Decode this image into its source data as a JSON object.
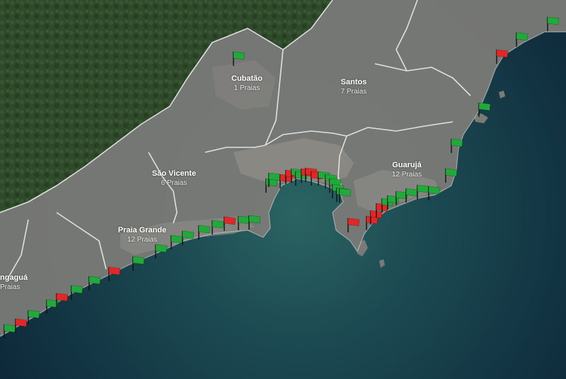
{
  "colors": {
    "forest": "#2f4a2c",
    "land": "#7a7a77",
    "border": "#e9e9e9",
    "sea_near": "#245c5c",
    "sea_far": "#0d2a3a",
    "flag_good": "#1faa3a",
    "flag_bad": "#e32626"
  },
  "cities": [
    {
      "name": "Cubatão",
      "count": "1 Praias"
    },
    {
      "name": "Santos",
      "count": "7 Praias"
    },
    {
      "name": "São Vicente",
      "count": "6 Praias"
    },
    {
      "name": "Guarujá",
      "count": "12 Praias"
    },
    {
      "name": "Praia Grande",
      "count": "12 Praias"
    },
    {
      "name": "ngaguá",
      "count": "Praias"
    }
  ],
  "flag_status": [
    "good",
    "bad",
    "good",
    "good",
    "bad",
    "good",
    "good",
    "bad",
    "good",
    "good",
    "good",
    "good",
    "good",
    "good",
    "bad",
    "good",
    "good",
    "good",
    "good",
    "bad",
    "bad",
    "good",
    "good",
    "bad",
    "bad",
    "bad",
    "good",
    "good",
    "good",
    "good",
    "good",
    "good",
    "bad",
    "bad",
    "bad",
    "bad",
    "good",
    "good",
    "good",
    "good",
    "good",
    "good",
    "good",
    "good",
    "good",
    "bad",
    "good",
    "good",
    "good",
    "good",
    "good",
    "good",
    "good",
    "good",
    "good",
    "bad",
    "bad",
    "good",
    "good",
    "bad",
    "bad",
    "bad",
    "bad",
    "bad",
    "good",
    "good",
    "bad",
    "bad",
    "good",
    "good",
    "good"
  ]
}
